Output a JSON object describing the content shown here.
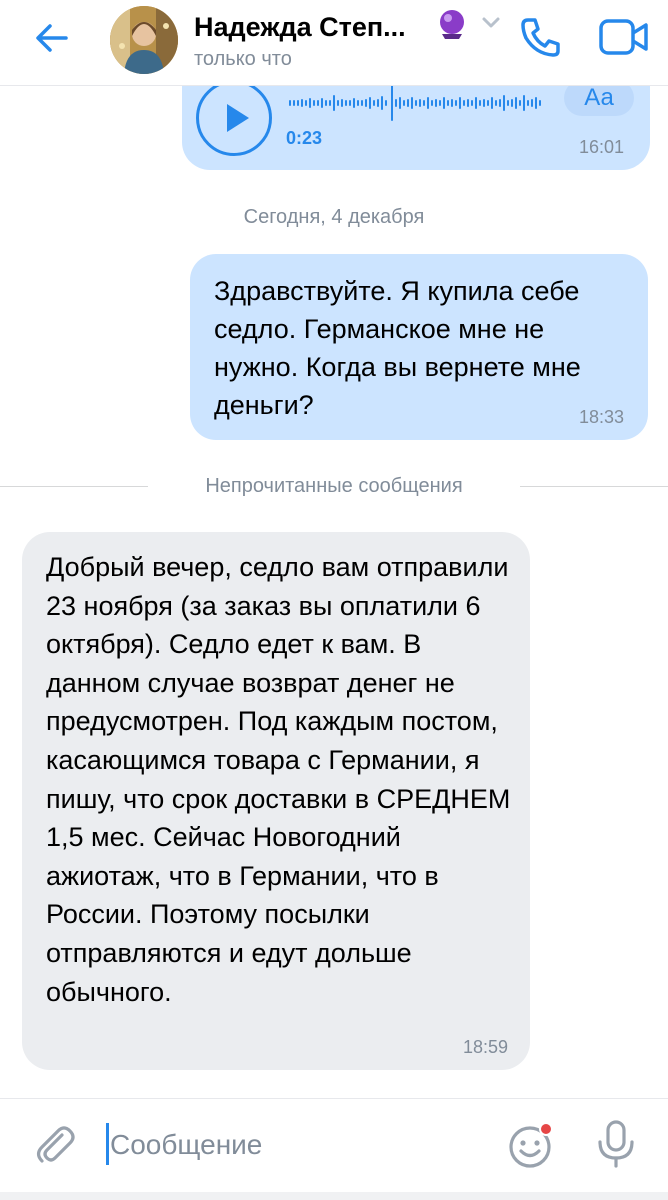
{
  "header": {
    "name": "Надежда Степ...",
    "status": "только что"
  },
  "voice_message": {
    "duration": "0:23",
    "transcribe_label": "Аа",
    "time": "16:01"
  },
  "date_separator": "Сегодня, 4 декабря",
  "messages": [
    {
      "direction": "outgoing",
      "text": "Здравствуйте. Я купила себе седло. Германское мне не нужно. Когда вы вернете мне деньги?",
      "time": "18:33"
    },
    {
      "direction": "incoming",
      "text": "Добрый вечер, седло вам отправили 23 ноября (за заказ вы оплатили 6 октября). Седло едет к вам. В данном случае возврат денег не предусмотрен. Под каждым постом, касающимся товара с Германии, я пишу, что срок доставки в СРЕДНЕМ 1,5 мес. Сейчас Новогодний ажиотаж, что в Германии, что в России. Поэтому посылки отправляются и едут дольше обычного.",
      "time": "18:59"
    }
  ],
  "unread_separator": "Непрочитанные сообщения",
  "composer": {
    "placeholder": "Сообщение"
  },
  "colors": {
    "accent": "#2688eb",
    "outgoing_bubble": "#cce4ff",
    "incoming_bubble": "#ebedf0",
    "secondary_text": "#818c99",
    "notification_dot": "#e64646"
  },
  "icons": [
    "back-arrow-icon",
    "crystal-ball-icon",
    "chevron-down-icon",
    "phone-icon",
    "video-camera-icon",
    "play-icon",
    "attach-icon",
    "smile-icon",
    "microphone-icon"
  ]
}
